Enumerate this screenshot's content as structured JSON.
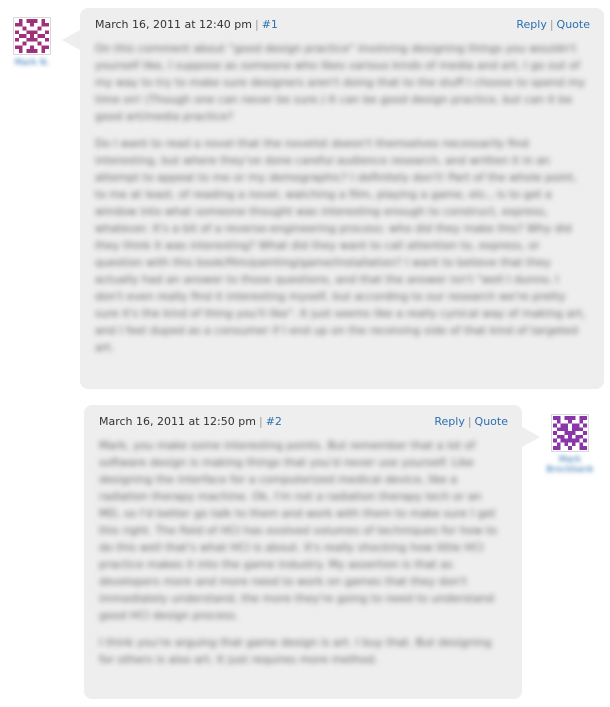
{
  "comments": [
    {
      "author": "Mark N.",
      "timestamp": "March 16, 2011 at 12:40 pm",
      "permalink": "#1",
      "reply_label": "Reply",
      "quote_label": "Quote",
      "paragraphs": [
        "On this comment about \"good design practice\" involving designing things you wouldn't yourself like, I suppose as someone who likes various kinds of media and art, I go out of my way to try to make sure designers aren't doing that to the stuff I choose to spend my time on! (Though one can never be sure.) It can be good design practice, but can it be good art/media practice?",
        "Do I want to read a novel that the novelist doesn't themselves necessarily find interesting, but where they've done careful audience research, and written it in an attempt to appeal to me or my demographic? I definitely don't! Part of the whole point, to me at least, of reading a novel, watching a film, playing a game, etc., is to get a window into what someone thought was interesting enough to construct, express, whatever. It's a bit of a reverse-engineering process: who did they make this? Why did they think it was interesting? What did they want to call attention to, express, or question with this book/film/painting/game/installation? I want to believe that they actually had an answer to those questions, and that the answer isn't \"well I dunno, I don't even really find it interesting myself, but according to our research we're pretty sure it's the kind of thing you'll like\". It just seems like a really cynical way of making art, and I feel duped as a consumer if I end up on the receiving side of that kind of targeted art."
      ]
    },
    {
      "author": "Mark Brockbank",
      "timestamp": "March 16, 2011 at 12:50 pm",
      "permalink": "#2",
      "reply_label": "Reply",
      "quote_label": "Quote",
      "paragraphs": [
        "Mark, you make some interesting points. But remember that a lot of software design is making things that you'd never use yourself. Like designing the interface for a computerized medical device, like a radiation therapy machine. Ok, I'm not a radiation therapy tech or an MD, so I'd better go talk to them and work with them to make sure I get this right. The field of HCI has evolved volumes of techniques for how to do this well that's what HCI is about. It's really shocking how little HCI practice makes it into the game industry. My assertion is that as developers more and more need to work on games that they don't immediately understand, the more they're going to need to understand good HCI design process.",
        "I think you're arguing that game design is art. I buy that. But designing for others is also art. It just requires more method."
      ]
    }
  ],
  "colors": {
    "bubble": "#eeeeee",
    "link": "#2a6fb0",
    "avatar": "#a0307a"
  }
}
